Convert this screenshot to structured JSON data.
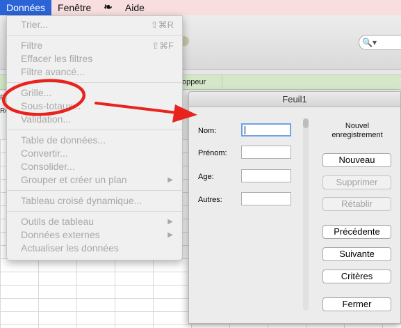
{
  "menubar": {
    "items": [
      {
        "label": "Données",
        "active": true
      },
      {
        "label": "Fenêtre",
        "active": false
      },
      {
        "label": "Aide",
        "active": false
      }
    ],
    "script_icon": "script-icon"
  },
  "background": {
    "column_header": "oppeur",
    "row_fragments": [
      "Fi",
      "Re"
    ]
  },
  "data_menu": {
    "items": {
      "trier": {
        "label": "Trier...",
        "shortcut": "⇧⌘R",
        "enabled": false
      },
      "filtre": {
        "label": "Filtre",
        "shortcut": "⇧⌘F",
        "enabled": false
      },
      "effacer": {
        "label": "Effacer les filtres",
        "enabled": false
      },
      "filtre_avance": {
        "label": "Filtre avancé...",
        "enabled": false
      },
      "grille": {
        "label": "Grille...",
        "enabled": false
      },
      "sous_totaux": {
        "label": "Sous-totaux...",
        "enabled": false
      },
      "validation": {
        "label": "Validation...",
        "enabled": false
      },
      "table": {
        "label": "Table de données...",
        "enabled": false
      },
      "convertir": {
        "label": "Convertir...",
        "enabled": false
      },
      "consolider": {
        "label": "Consolider...",
        "enabled": false
      },
      "grouper": {
        "label": "Grouper et créer un plan",
        "submenu": true,
        "enabled": false
      },
      "tcd": {
        "label": "Tableau croisé dynamique...",
        "enabled": false
      },
      "outils": {
        "label": "Outils de tableau",
        "submenu": true,
        "enabled": false
      },
      "externes": {
        "label": "Données externes",
        "submenu": true,
        "enabled": false
      },
      "actualiser": {
        "label": "Actualiser les données",
        "enabled": false
      }
    }
  },
  "form": {
    "title": "Feuil1",
    "record_label": "Nouvel enregistrement",
    "fields": [
      {
        "label": "Nom:",
        "value": ""
      },
      {
        "label": "Prénom:",
        "value": ""
      },
      {
        "label": "Age:",
        "value": ""
      },
      {
        "label": "Autres:",
        "value": ""
      }
    ],
    "buttons": {
      "nouveau": {
        "label": "Nouveau",
        "enabled": true
      },
      "supprimer": {
        "label": "Supprimer",
        "enabled": false
      },
      "retablir": {
        "label": "Rétablir",
        "enabled": false
      },
      "precedente": {
        "label": "Précédente",
        "enabled": true
      },
      "suivante": {
        "label": "Suivante",
        "enabled": true
      },
      "criteres": {
        "label": "Critères",
        "enabled": true
      },
      "fermer": {
        "label": "Fermer",
        "enabled": true
      }
    }
  },
  "colors": {
    "accent": "#2a64d6",
    "annotation": "#e8231e",
    "menubar_bg": "#f8dede",
    "header_green": "#d4e8c9"
  }
}
